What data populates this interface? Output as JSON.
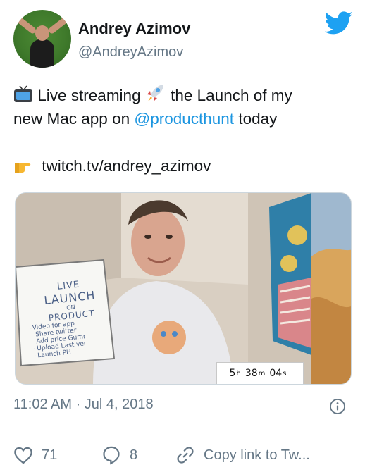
{
  "author": {
    "display_name": "Andrey Azimov",
    "handle": "@AndreyAzimov"
  },
  "tweet": {
    "line1_prefix": "Live streaming",
    "line1_suffix": "the Launch of my",
    "line2_prefix": "new Mac app on",
    "mention": "@producthunt",
    "line2_suffix": "today",
    "link": "twitch.tv/andrey_azimov",
    "emojis": [
      "tv-icon",
      "rocket-icon",
      "pointing-hand-icon"
    ]
  },
  "media": {
    "whiteboard_lines": [
      "LIVE",
      "LAUNCH",
      "ON",
      "PRODUCT",
      "-Video for app",
      "- Share twitter",
      "- Add price Gumr",
      "- Upload Last ver",
      "- Launch PH"
    ],
    "timer": {
      "h": "5",
      "h_unit": "h",
      "m": "38",
      "m_unit": "m",
      "s": "04",
      "s_unit": "s"
    }
  },
  "meta": {
    "timestamp": "11:02 AM · Jul 4, 2018"
  },
  "actions": {
    "likes": "71",
    "replies": "8",
    "copy_link": "Copy link to Tw..."
  },
  "colors": {
    "accent": "#1b95e0",
    "secondary_text": "#657786",
    "divider": "#e1e8ed"
  }
}
